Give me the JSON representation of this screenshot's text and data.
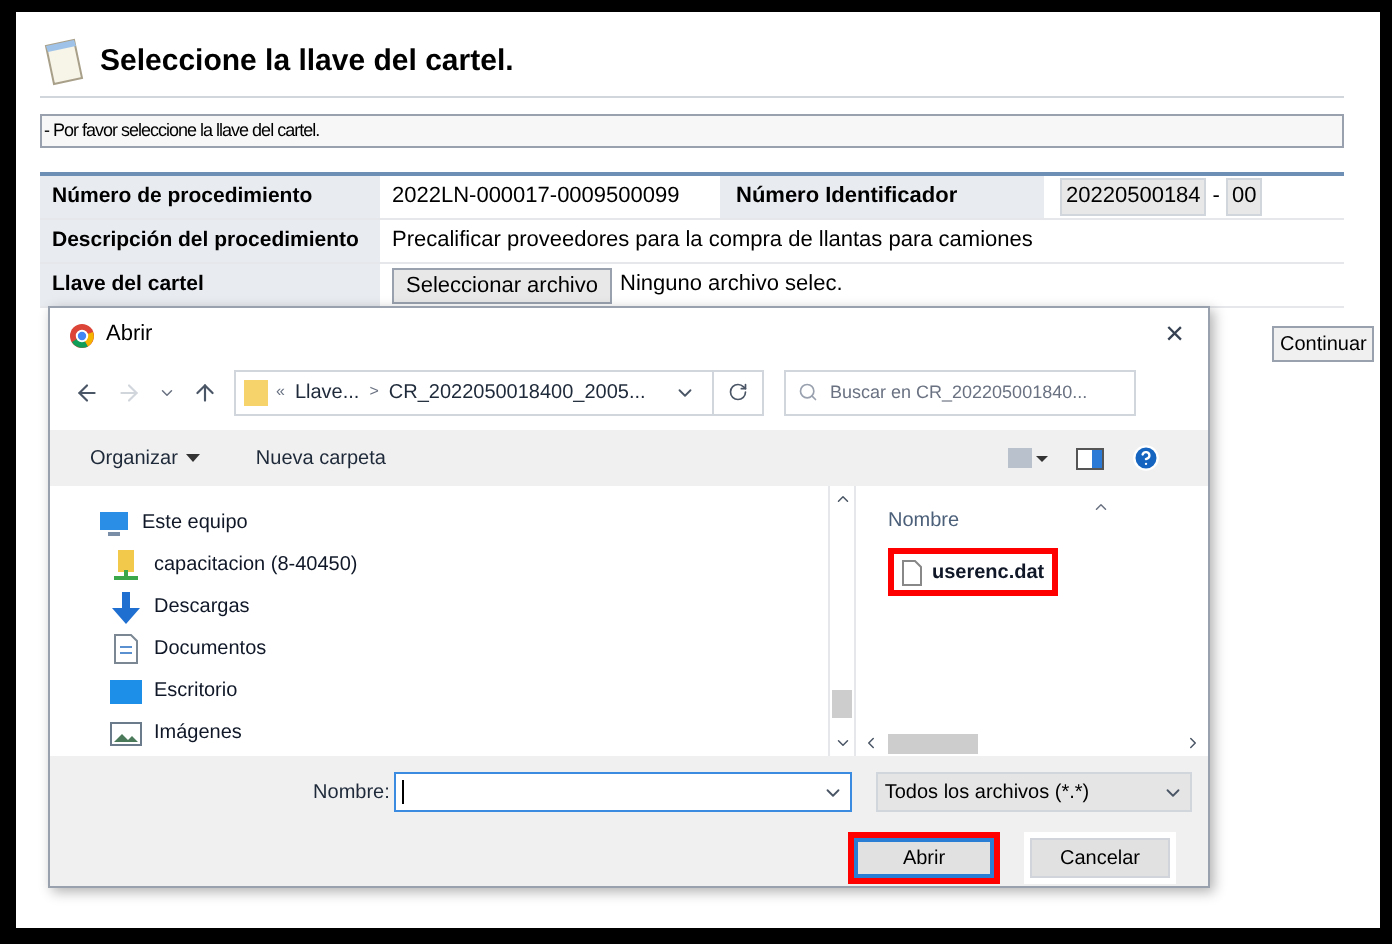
{
  "page": {
    "title": "Seleccione la llave del cartel.",
    "message": "- Por favor seleccione la llave del cartel.",
    "rows": [
      {
        "label": "Número de procedimiento",
        "value": "2022LN-000017-0009500099",
        "label2": "Número Identificador",
        "id_parts": [
          "20220500184",
          "-",
          "00"
        ]
      },
      {
        "label": "Descripción del procedimiento",
        "value": "Precalificar proveedores para la compra de llantas para camiones"
      },
      {
        "label": "Llave del cartel",
        "file_button": "Seleccionar archivo",
        "file_status": "Ninguno archivo selec."
      }
    ],
    "continue_button": "Continuar"
  },
  "dialog": {
    "title": "Abrir",
    "close": "×",
    "path": [
      "«",
      "Llave...",
      ">",
      "CR_2022050018400_2005..."
    ],
    "search": {
      "placeholder": "Buscar en CR_202205001840..."
    },
    "toolbar": [
      "Organizar",
      "Nueva carpeta"
    ],
    "nav_items": [
      {
        "label": "Este equipo",
        "kind": "computer",
        "indent": false
      },
      {
        "label": "capacitacion (8-40450)",
        "kind": "network",
        "indent": true
      },
      {
        "label": "Descargas",
        "kind": "download",
        "indent": true
      },
      {
        "label": "Documentos",
        "kind": "document",
        "indent": true
      },
      {
        "label": "Escritorio",
        "kind": "desktop",
        "indent": true
      },
      {
        "label": "Imágenes",
        "kind": "pictures",
        "indent": true
      }
    ],
    "column": "Nombre",
    "files": [
      {
        "name": "userenc.dat",
        "highlighted": true
      }
    ],
    "filename_label": "Nombre:",
    "filter": "Todos los archivos (*.*)",
    "buttons": [
      {
        "label": "Abrir",
        "highlighted": true
      },
      {
        "label": "Cancelar",
        "highlighted": false
      }
    ]
  }
}
